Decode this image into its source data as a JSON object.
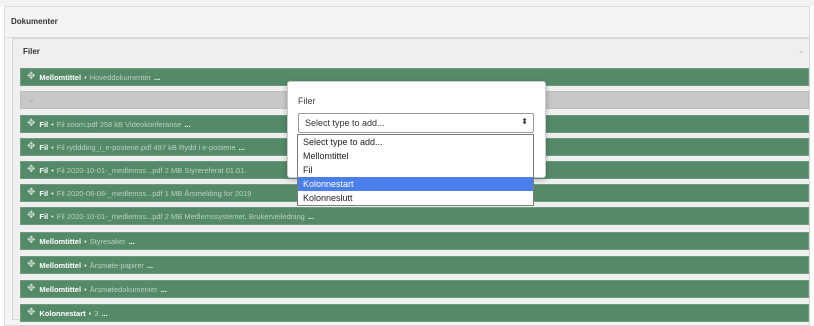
{
  "panel": {
    "title": "Dokumenter"
  },
  "files": {
    "title": "Filer",
    "rows": [
      {
        "type": "Mellomtittel",
        "desc": "Hoveddokumenter",
        "dots": "..."
      },
      {
        "type": "",
        "desc": "",
        "dots": ""
      },
      {
        "type": "Fil",
        "desc": "Fil zoom.pdf 258 kB Videokonferanse",
        "dots": "..."
      },
      {
        "type": "Fil",
        "desc": "Fil ryddding_i_e-postene.pdf 497 kB Rydd i e-postene",
        "dots": "..."
      },
      {
        "type": "Fil",
        "desc": "Fil 2020-10-01-_medlemss...pdf 2 MB Styrereferat 01.01.",
        "dots": ""
      },
      {
        "type": "Fil",
        "desc": "Fil 2020-06-08-_medlemss...pdf 1 MB Årsmelding for 2019",
        "dots": ""
      },
      {
        "type": "Fil",
        "desc": "Fil 2020-10-01-_medlemss...pdf 2 MB Medlemssystemet. Brukerveiledning",
        "dots": "..."
      },
      {
        "type": "Mellomtittel",
        "desc": "Styresaker",
        "dots": "..."
      },
      {
        "type": "Mellomtittel",
        "desc": "Årsmøte-papirer",
        "dots": "..."
      },
      {
        "type": "Mellomtittel",
        "desc": "Årsmøtedokumenter",
        "dots": "..."
      },
      {
        "type": "Kolonnestart",
        "desc": "3",
        "dots": "..."
      }
    ]
  },
  "modal": {
    "label": "Filer",
    "select_value": "Select type to add...",
    "select_arrows": "⬍",
    "options": [
      "Select type to add...",
      "Mellomtittel",
      "Fil",
      "Kolonnestart",
      "Kolonneslutt"
    ],
    "selected_option": "Kolonnestart"
  },
  "icons": {
    "move": "✥",
    "chevron": "⌄"
  },
  "colors": {
    "row_green": "#548a67",
    "highlight": "#4a7ee8"
  }
}
